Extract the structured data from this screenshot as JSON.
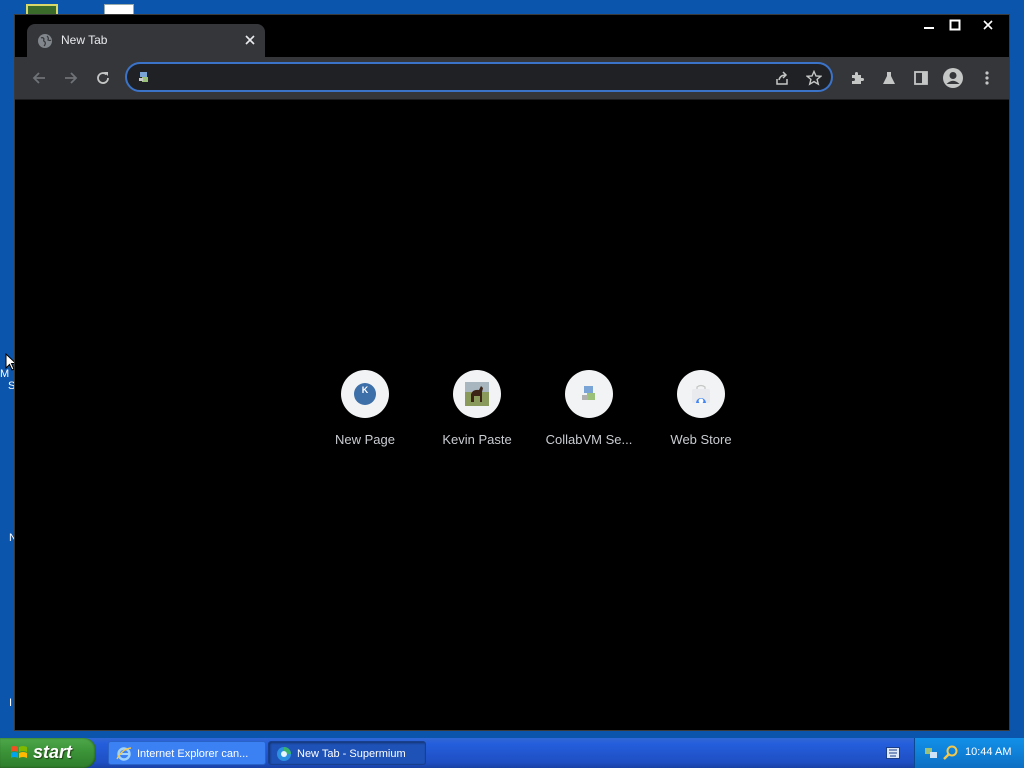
{
  "browser": {
    "tab": {
      "title": "New Tab"
    },
    "omnibox": {
      "value": ""
    },
    "shortcuts": [
      {
        "label": "New Page",
        "icon": "new-page-favicon"
      },
      {
        "label": "Kevin Paste",
        "icon": "horse-thumbnail"
      },
      {
        "label": "CollabVM Se...",
        "icon": "collabvm-favicon"
      },
      {
        "label": "Web Store",
        "icon": "web-store-favicon"
      }
    ]
  },
  "taskbar": {
    "start_label": "start",
    "tasks": [
      {
        "label": "Internet Explorer can..."
      },
      {
        "label": "New Tab - Supermium"
      }
    ],
    "clock": "10:44 AM"
  },
  "desktop": {
    "fragments": [
      "M",
      "S",
      "N",
      "I"
    ]
  },
  "colors": {
    "desktop": "#0b55ad",
    "tab_bg": "#35363a",
    "toolbar_bg": "#35363a",
    "omnibox_border": "#3b73c8",
    "content_bg": "#000000",
    "shortcut_circle": "#f1f3f4"
  }
}
